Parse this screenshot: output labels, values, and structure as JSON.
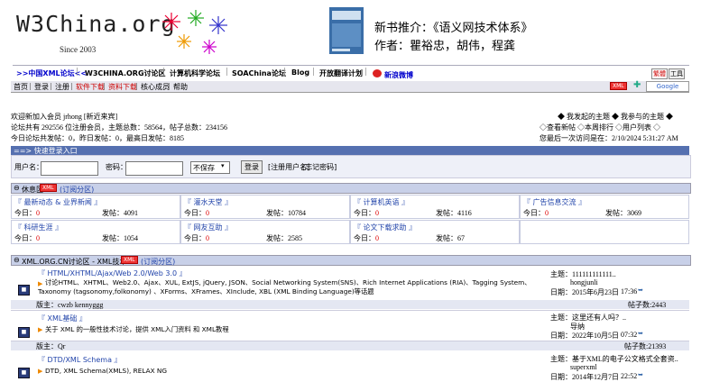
{
  "header": {
    "logo": "W3China.org",
    "since": "Since 2003",
    "book_title": "新书推介：《语义网技术体系》",
    "book_authors": "作者：瞿裕忠，胡伟，程龚"
  },
  "nav": {
    "items": [
      ">>中国XML论坛<<",
      "W3CHINA.ORG讨论区",
      "计算机科学论坛",
      "SOAChina论坛",
      "Blog",
      "开放翻译计划",
      "新浪微博"
    ],
    "theme": "繁體",
    "tool": "工具"
  },
  "menu": {
    "items": [
      "首页",
      "登录",
      "注册",
      "软件下载",
      "资料下载",
      "核心成员",
      "帮助"
    ],
    "xml_badge": "XML",
    "google": "Google"
  },
  "info": {
    "welcome": "欢迎新加入会员 jrhong [新近来宾]",
    "stats": "论坛共有 292556 位注册会员，主题总数：58564，帖子总数：234156",
    "today": "今日论坛共发帖：0，昨日发帖：0，最高日发帖：8185",
    "right1": "◆ 我发起的主题 ◆ 我参与的主题 ◆",
    "right2": "◇查看新帖 ◇本周排行 ◇用户列表 ◇",
    "right3": "您最后一次访问是在：2/10/2024 5:31:27 AM"
  },
  "quick_login": {
    "bar": "==> 快速登录入口",
    "user_label": "用户名：",
    "pass_label": "密码：",
    "remember": "不保存",
    "login_btn": "登录",
    "register": "[注册用户名]",
    "forgot": "[忘记密码]"
  },
  "leisure": {
    "name": "休息区",
    "badge": "XML",
    "subscribe": "(订阅分区)",
    "boards": [
      {
        "title": "『 最新动态 & 业界新闻 』",
        "today": "今日：0",
        "posts": "发帖：4091"
      },
      {
        "title": "『 灌水天堂 』",
        "today": "今日：0",
        "posts": "发帖：10784"
      },
      {
        "title": "『 计算机英语 』",
        "today": "今日：0",
        "posts": "发帖：4116"
      },
      {
        "title": "『 广告信息交流 』",
        "today": "今日：0",
        "posts": "发帖：3069"
      },
      {
        "title": "『 科研生涯 』",
        "today": "今日：0",
        "posts": "发帖：1054"
      },
      {
        "title": "『 网友互助 』",
        "today": "今日：0",
        "posts": "发帖：2585"
      },
      {
        "title": "『 论文下载求助 』",
        "today": "今日：0",
        "posts": "发帖：67"
      }
    ]
  },
  "xmlzone": {
    "name": "XML.ORG.CN讨论区 - XML技术",
    "badge": "XML",
    "subscribe": "(订阅分区)",
    "forums": [
      {
        "title": "『 HTML/XHTML/Ajax/Web 2.0/Web 3.0 』",
        "desc1": "讨论HTML、XHTML、Web2.0、Ajax、XUL, ExtJS, jQuery, JSON、Social Networking System(SNS)、Rich Internet Applications (RIA)、Tagging System、",
        "desc2": "Taxonomy (tagsonomy,folkonomy) 、XForms、XFrames、XInclude, XBL (XML Binding Language)等话题",
        "moderator": "版主：cwzb kennyggg",
        "subject": "主题：111111111111..",
        "author": "hongjunli",
        "date": "日期：2015年6月23日",
        "time": "17:36",
        "posts": "帖子数:2443"
      },
      {
        "title": "『 XML基础 』",
        "desc1": "关于 XML 的一般性技术讨论，提供 XML入门资料 和 XML教程",
        "desc2": "",
        "moderator": "版主：Qr",
        "subject": "主题：这里还有人吗？..",
        "author": "导纳",
        "date": "日期：2022年10月5日",
        "time": "07:32",
        "posts": "帖子数:21393"
      },
      {
        "title": "『 DTD/XML Schema 』",
        "desc1": "DTD, XML Schema(XMLS), RELAX NG",
        "desc2": "",
        "moderator": "",
        "subject": "主题：基于XML的电子公文格式全套资..",
        "author": "superxml",
        "date": "日期：2014年12月7日",
        "time": "22:52",
        "posts": ""
      }
    ]
  },
  "labels": {
    "today_prefix": "今日：",
    "posts_prefix": "发帖："
  }
}
